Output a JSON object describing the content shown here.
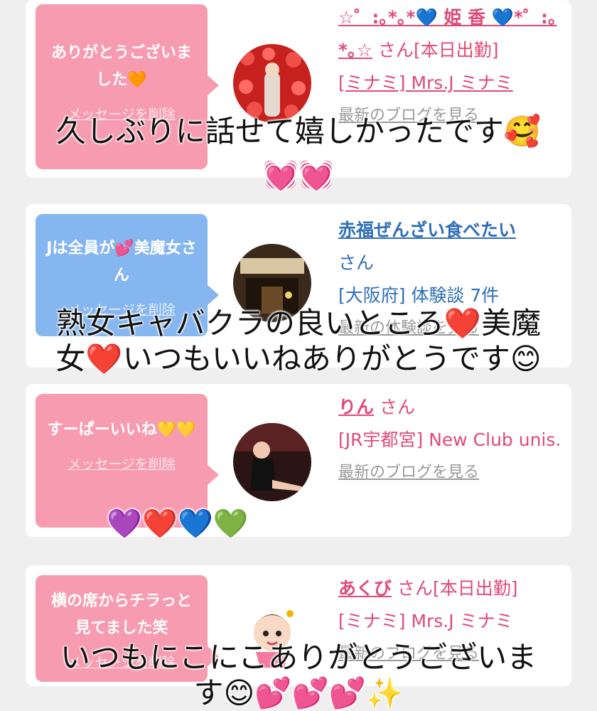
{
  "cards": [
    {
      "bubble_message": "ありがとうございました🧡",
      "delete_label": "メッセージを削除",
      "name": "☆゜:｡*｡*💙 姫 香 💙*゜:｡*｡☆",
      "suffix": "さん[本日出勤]",
      "shop": "[ミナミ] Mrs.J ミナミ",
      "link": "最新のブログを見る"
    },
    {
      "bubble_message": "Jは全員が💕美魔女さん",
      "delete_label": "メッセージを削除",
      "name": "赤福ぜんざい食べたい",
      "suffix": "さん",
      "shop": "[大阪府] 体験談 7件",
      "link": "最新の体験談を見る"
    },
    {
      "bubble_message": "すーぱーいいね💛💛",
      "delete_label": "メッセージを削除",
      "name": "りん",
      "suffix": "さん",
      "shop": "[JR宇都宮] New Club unis.",
      "link": "最新のブログを見る"
    },
    {
      "bubble_message": "横の席からチラっと見てました笑",
      "delete_label": "メッセージを削除",
      "name": "あくび",
      "suffix": "さん[本日出勤]",
      "shop": "[ミナミ] Mrs.J ミナミ",
      "link": "最新のブログを見る"
    }
  ],
  "overlays": [
    "久しぶりに話せて嬉しかったです🥰",
    "💓💓",
    "熟女キャバクラの良いところ❤️美魔\n女❤️いつもいいねありがとうです😊",
    "💜❤️💙💚",
    "いつもにこにこありがとうございま\nす😊💕💕💕✨"
  ],
  "colors": {
    "pink_bubble": "#f79bb0",
    "blue_bubble": "#86b6ef",
    "name_pink": "#e04a76",
    "name_blue": "#2f6fb7"
  }
}
